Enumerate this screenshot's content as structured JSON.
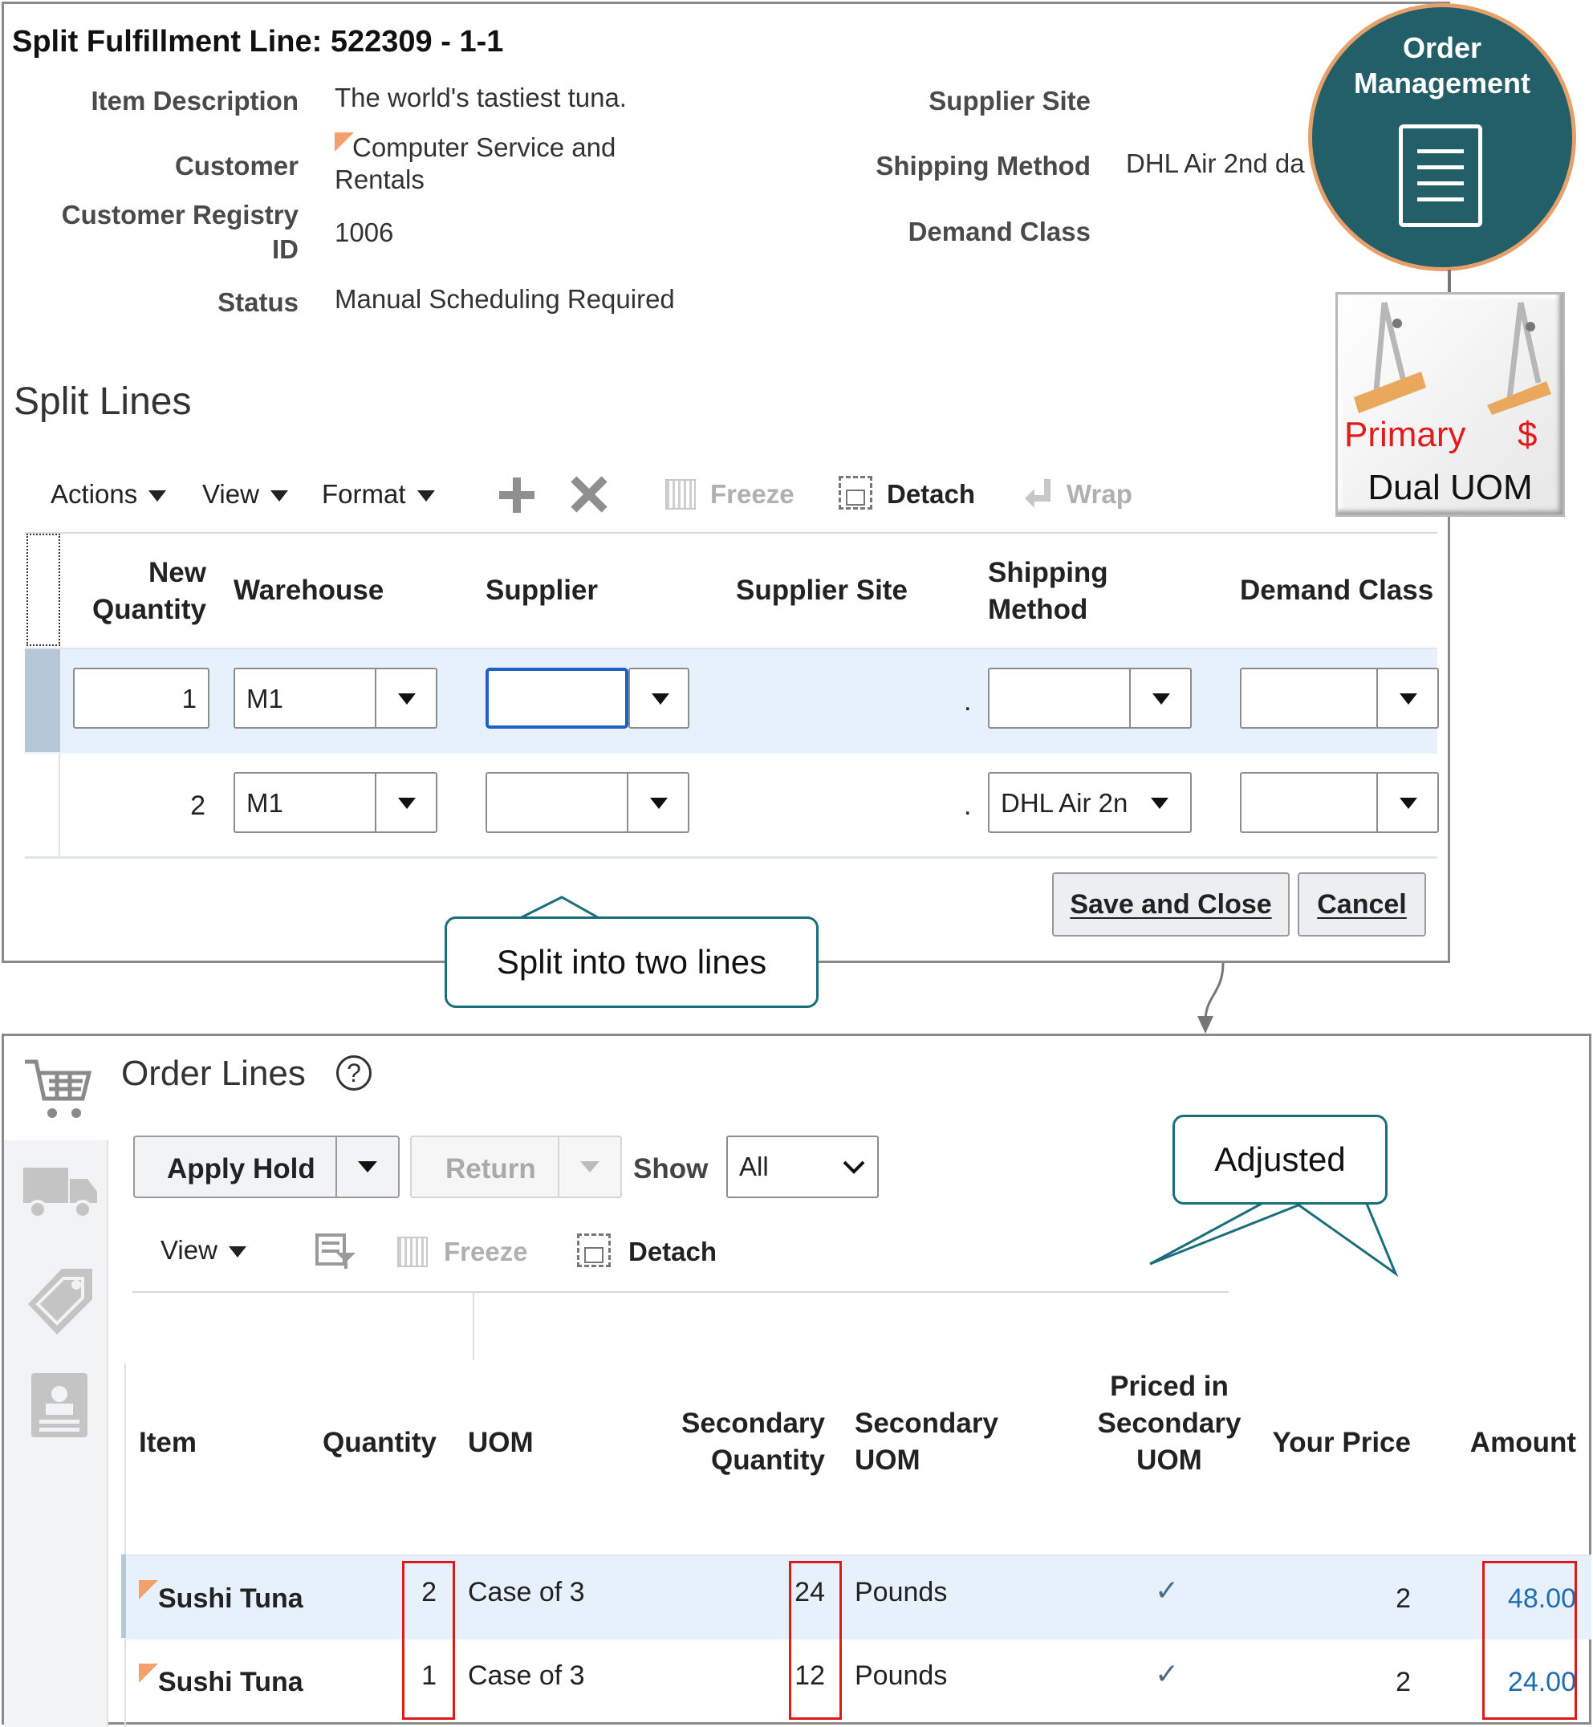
{
  "split": {
    "title": "Split Fulfillment Line: 522309 - 1-1",
    "fields": {
      "item_description_label": "Item Description",
      "item_description_value": "The world's tastiest tuna.",
      "customer_label": "Customer",
      "customer_value_line1": "Computer Service and",
      "customer_value_line2": "Rentals",
      "registry_label_line1": "Customer Registry",
      "registry_label_line2": "ID",
      "registry_value": "1006",
      "status_label": "Status",
      "status_value": "Manual Scheduling Required",
      "supplier_site_label": "Supplier Site",
      "shipping_method_label": "Shipping Method",
      "shipping_method_value": "DHL Air 2nd da",
      "demand_class_label": "Demand Class"
    },
    "section_title": "Split Lines",
    "toolbar": {
      "actions": "Actions",
      "view": "View",
      "format": "Format",
      "freeze": "Freeze",
      "detach": "Detach",
      "wrap": "Wrap"
    },
    "columns": {
      "new_quantity_1": "New",
      "new_quantity_2": "Quantity",
      "warehouse": "Warehouse",
      "supplier": "Supplier",
      "supplier_site": "Supplier Site",
      "shipping_method_1": "Shipping",
      "shipping_method_2": "Method",
      "demand_class": "Demand Class"
    },
    "rows": [
      {
        "new_quantity": "1",
        "warehouse": "M1",
        "supplier": "",
        "supplier_site": ".",
        "shipping_method": "",
        "demand_class": ""
      },
      {
        "new_quantity": "2",
        "warehouse": "M1",
        "supplier": "",
        "supplier_site": ".",
        "shipping_method": "DHL Air 2n",
        "demand_class": ""
      }
    ],
    "save_and_close": "Save and Close",
    "cancel": "Cancel"
  },
  "callouts": {
    "split_into_two": "Split into two lines",
    "adjusted": "Adjusted"
  },
  "badge": {
    "line1": "Order",
    "line2": "Management"
  },
  "dual_uom": {
    "primary": "Primary",
    "dollar": "$",
    "label": "Dual UOM"
  },
  "order_lines": {
    "title": "Order Lines",
    "apply_hold": "Apply Hold",
    "return": "Return",
    "show_label": "Show",
    "show_value": "All",
    "view": "View",
    "freeze": "Freeze",
    "detach": "Detach",
    "columns": {
      "item": "Item",
      "quantity": "Quantity",
      "uom": "UOM",
      "secondary_quantity_1": "Secondary",
      "secondary_quantity_2": "Quantity",
      "secondary_uom_1": "Secondary",
      "secondary_uom_2": "UOM",
      "priced_1": "Priced in",
      "priced_2": "Secondary",
      "priced_3": "UOM",
      "your_price": "Your Price",
      "amount": "Amount"
    },
    "rows": [
      {
        "item": "Sushi Tuna",
        "quantity": "2",
        "uom": "Case of 3",
        "secondary_quantity": "24",
        "secondary_uom": "Pounds",
        "priced_check": "✓",
        "your_price": "2",
        "amount": "48.00"
      },
      {
        "item": "Sushi Tuna",
        "quantity": "1",
        "uom": "Case of 3",
        "secondary_quantity": "12",
        "secondary_uom": "Pounds",
        "priced_check": "✓",
        "your_price": "2",
        "amount": "24.00"
      }
    ]
  },
  "colors": {
    "teal": "#235f69",
    "callout_border": "#1a6e7a",
    "highlight_red": "#e01818",
    "row_selected": "#e6f1fb",
    "link_blue": "#1c6db5"
  }
}
